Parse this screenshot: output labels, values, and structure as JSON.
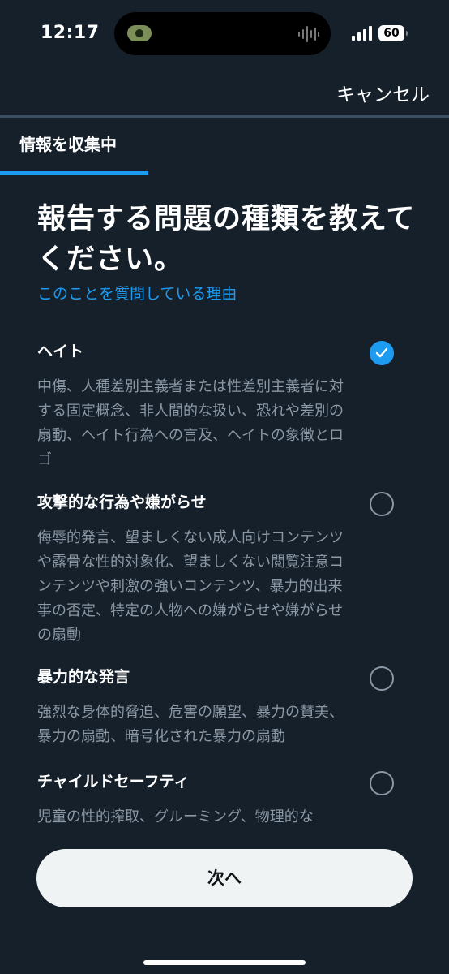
{
  "status": {
    "time": "12:17",
    "battery": "60"
  },
  "header": {
    "cancel_label": "キャンセル"
  },
  "step": {
    "label": "情報を収集中"
  },
  "main": {
    "headline": "報告する問題の種類を教えてください。",
    "why_link": "このことを質問している理由",
    "options": [
      {
        "title": "ヘイト",
        "desc": "中傷、人種差別主義者または性差別主義者に対する固定概念、非人間的な扱い、恐れや差別の扇動、ヘイト行為への言及、ヘイトの象徴とロゴ",
        "selected": true
      },
      {
        "title": "攻撃的な行為や嫌がらせ",
        "desc": "侮辱的発言、望ましくない成人向けコンテンツや露骨な性的対象化、望ましくない閲覧注意コンテンツや刺激の強いコンテンツ、暴力的出来事の否定、特定の人物への嫌がらせや嫌がらせの扇動",
        "selected": false
      },
      {
        "title": "暴力的な発言",
        "desc": "強烈な身体的脅迫、危害の願望、暴力の賛美、暴力の扇動、暗号化された暴力の扇動",
        "selected": false
      },
      {
        "title": "チャイルドセーフティ",
        "desc": "児童の性的搾取、グルーミング、物理的な",
        "selected": false
      }
    ]
  },
  "footer": {
    "next_label": "次へ"
  },
  "colors": {
    "background": "#15202b",
    "accent": "#1d9bf0",
    "muted_text": "#8b98a5",
    "button_bg": "#eff3f4"
  }
}
